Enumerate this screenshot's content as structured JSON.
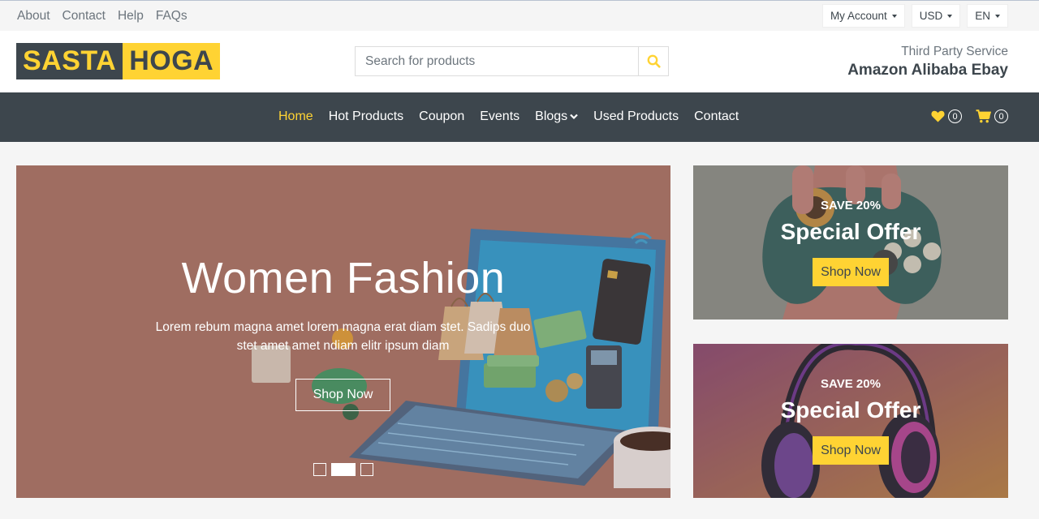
{
  "topbar": {
    "links": [
      "About",
      "Contact",
      "Help",
      "FAQs"
    ],
    "account_label": "My Account",
    "currency_label": "USD",
    "language_label": "EN"
  },
  "header": {
    "logo_part1": "SASTA",
    "logo_part2": "HOGA",
    "search_placeholder": "Search for products",
    "third_party_label": "Third Party Service",
    "third_party_names": "Amazon Alibaba Ebay"
  },
  "nav": {
    "items": [
      "Home",
      "Hot Products",
      "Coupon",
      "Events",
      "Blogs",
      "Used Products",
      "Contact"
    ],
    "active_index": 0,
    "wishlist_count": "0",
    "cart_count": "0"
  },
  "carousel": {
    "title": "Women Fashion",
    "text": "Lorem rebum magna amet lorem magna erat diam stet. Sadips duo stet amet amet ndiam elitr ipsum diam",
    "button_label": "Shop Now",
    "slide_count": 3,
    "active_slide": 1
  },
  "offers": [
    {
      "save": "SAVE 20%",
      "title": "Special Offer",
      "button_label": "Shop Now",
      "image": "gamepad"
    },
    {
      "save": "SAVE 20%",
      "title": "Special Offer",
      "button_label": "Shop Now",
      "image": "headphones"
    }
  ],
  "colors": {
    "accent": "#ffd333",
    "dark": "#3d464d",
    "muted": "#6c757d",
    "page_bg": "#f5f5f5"
  },
  "icons": {
    "search": "search-icon",
    "heart": "heart-icon",
    "cart": "cart-icon",
    "chevron": "chevron-down-icon"
  }
}
